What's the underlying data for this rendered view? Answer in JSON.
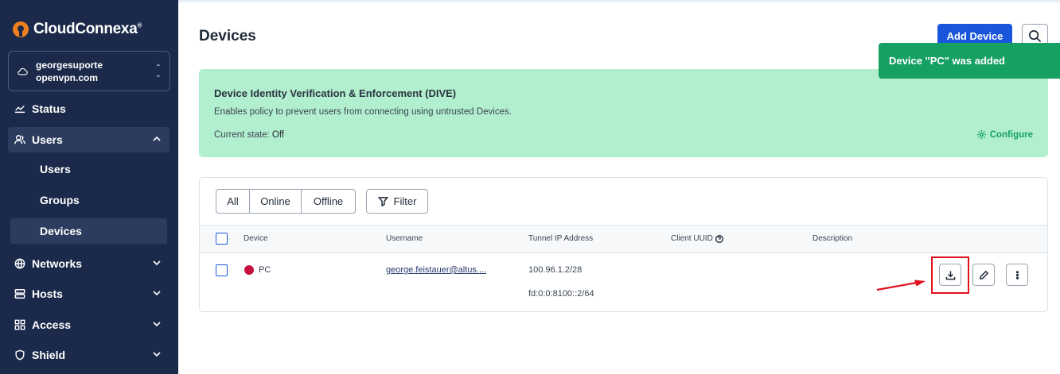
{
  "sidebar": {
    "brand": "CloudConnexa",
    "brand_mark": "®",
    "org_name": "georgesuporte",
    "org_domain": "openvpn.com",
    "items": [
      {
        "label": "Status",
        "icon": "status-chart-icon"
      },
      {
        "label": "Users",
        "icon": "users-icon",
        "expanded": true
      },
      {
        "label": "Networks",
        "icon": "globe-icon"
      },
      {
        "label": "Hosts",
        "icon": "server-icon"
      },
      {
        "label": "Access",
        "icon": "grid-icon"
      },
      {
        "label": "Shield",
        "icon": "shield-icon"
      }
    ],
    "sub_items": [
      {
        "label": "Users"
      },
      {
        "label": "Groups"
      },
      {
        "label": "Devices",
        "active": true
      }
    ]
  },
  "header": {
    "title": "Devices",
    "add_button": "Add Device"
  },
  "toast": {
    "message": "Device \"PC\" was added"
  },
  "dive": {
    "title": "Device Identity Verification & Enforcement (DIVE)",
    "description": "Enables policy to prevent users from connecting using untrusted Devices.",
    "state_label": "Current state:",
    "state_value": "Off",
    "configure": "Configure"
  },
  "filters": {
    "tabs": [
      "All",
      "Online",
      "Offline"
    ],
    "filter_button": "Filter"
  },
  "table": {
    "columns": [
      "Device",
      "Username",
      "Tunnel IP Address",
      "Client UUID",
      "Description"
    ],
    "rows": [
      {
        "device": "PC",
        "status_color": "#c8103e",
        "username": "george.feistauer@altus....",
        "ipv4": "100.96.1.2/28",
        "ipv6": "fd:0:0:8100::2/64",
        "description": ""
      }
    ]
  },
  "colors": {
    "sidebar_bg": "#1b2a4a",
    "primary": "#1a56db",
    "success": "#16a163",
    "dive_bg": "#b2efcf",
    "annotation_red": "#e0101c"
  }
}
